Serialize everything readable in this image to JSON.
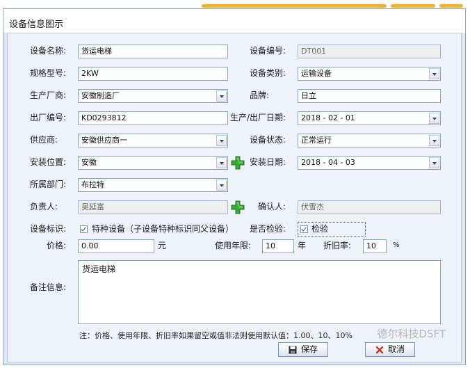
{
  "window": {
    "title": "设备信息图示"
  },
  "form": {
    "device_name": {
      "label": "设备名称:",
      "value": "货运电梯"
    },
    "device_code": {
      "label": "设备编号:",
      "value": "DT001"
    },
    "spec_model": {
      "label": "规格型号:",
      "value": "2KW"
    },
    "device_category": {
      "label": "设备类别:",
      "value": "运输设备"
    },
    "manufacturer": {
      "label": "生产厂商:",
      "value": "安徽制造厂"
    },
    "brand": {
      "label": "品牌:",
      "value": "日立"
    },
    "factory_number": {
      "label": "出厂编号:",
      "value": "KD0293812"
    },
    "production_date": {
      "label": "生产/出厂日期:",
      "value": "2018 - 02 - 01"
    },
    "supplier": {
      "label": "供应商:",
      "value": "安徽供应商一"
    },
    "device_status": {
      "label": "设备状态:",
      "value": "正常运行"
    },
    "install_location": {
      "label": "安装位置:",
      "value": "安徽"
    },
    "install_date": {
      "label": "安装日期:",
      "value": "2018 - 04 - 03"
    },
    "department": {
      "label": "所属部门:",
      "value": "布拉特"
    },
    "person_in_charge": {
      "label": "负责人:",
      "value": "吴延富"
    },
    "confirmer": {
      "label": "确认人:",
      "value": "伏雪杰"
    },
    "device_mark": {
      "label": "设备标识:",
      "checkbox_label": "特种设备（子设备特种标识同父设备）",
      "checked": true
    },
    "inspection": {
      "label": "是否检验:",
      "checkbox_label": "检验",
      "checked": true
    },
    "price": {
      "label": "价格:",
      "value": "0.00",
      "unit": "元"
    },
    "service_years": {
      "label": "使用年限:",
      "value": "10",
      "unit": "年"
    },
    "depreciation": {
      "label": "折旧率:",
      "value": "10",
      "unit": "%"
    },
    "remarks": {
      "label": "备注信息:",
      "value": "货运电梯"
    },
    "note": "注：价格、使用年限、折旧率如果留空或值非法则使用默认值：1.00、10、10%"
  },
  "buttons": {
    "save": "保存",
    "cancel": "取消"
  },
  "watermark": "德尔科技DSFT",
  "colors": {
    "accent_orange": "#f0b030",
    "panel_bg": "#eef3fa",
    "plus_green": "#3aa53a",
    "cancel_red": "#d23020"
  }
}
